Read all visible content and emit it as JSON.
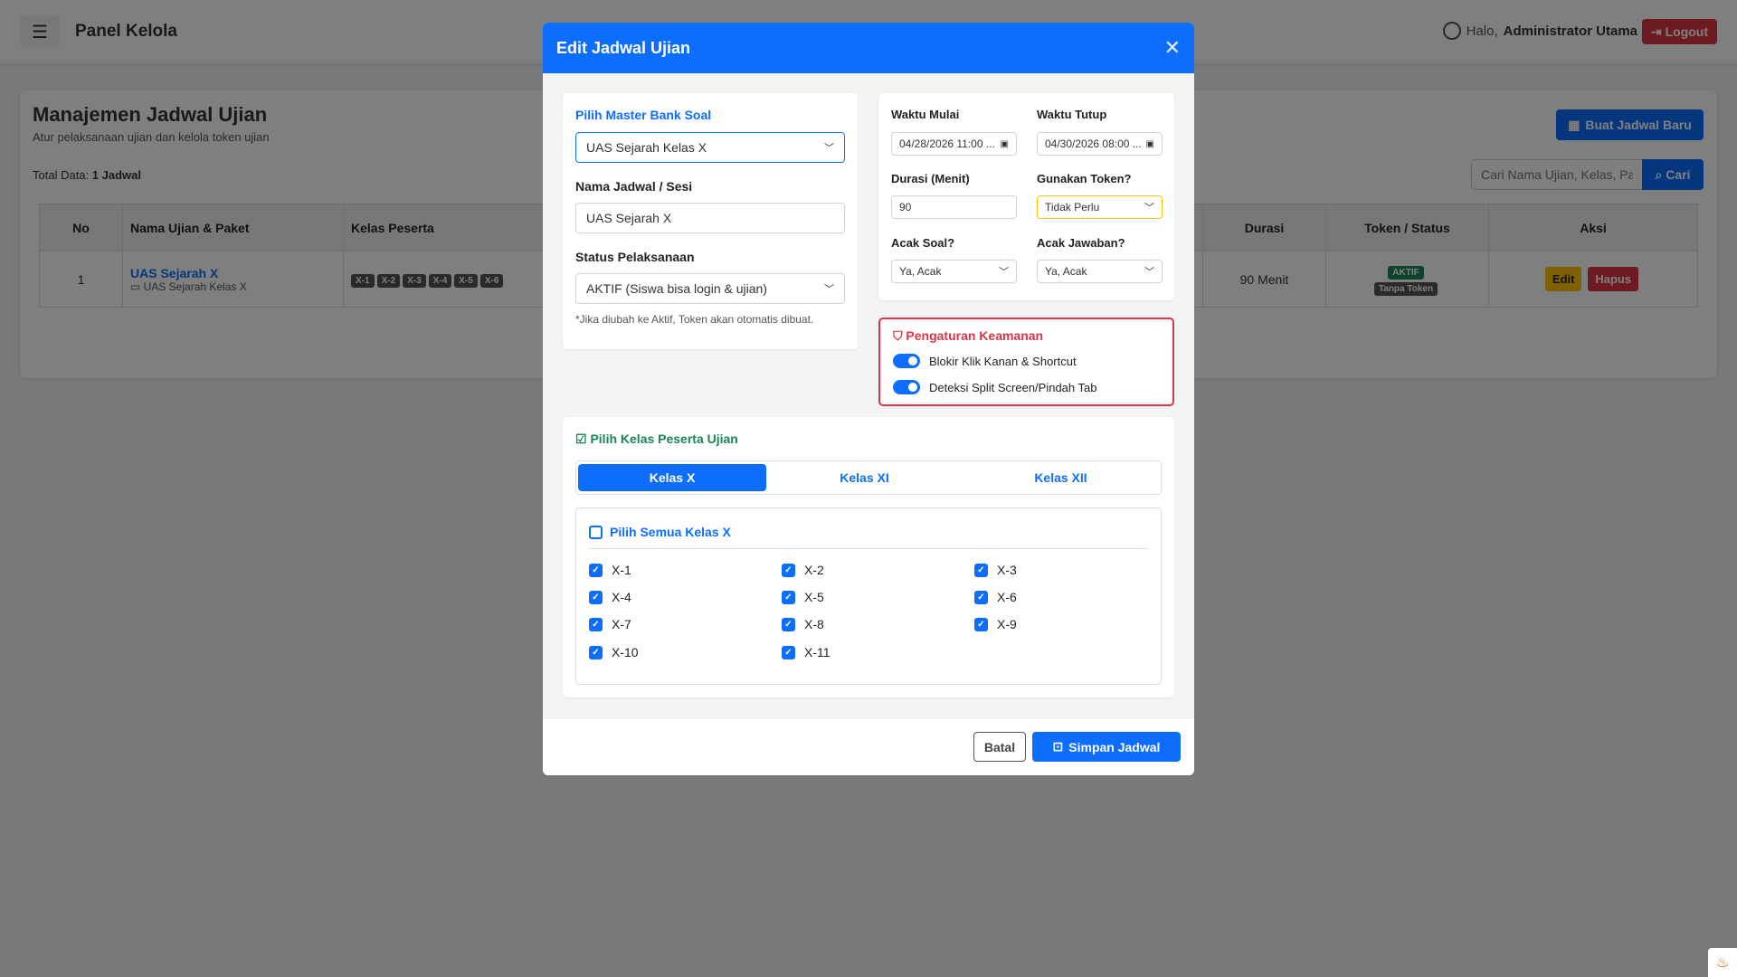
{
  "navbar": {
    "brand": "Panel Kelola",
    "greeting": "Halo,",
    "user": "Administrator Utama",
    "logout": "Logout"
  },
  "page": {
    "title": "Manajemen Jadwal Ujian",
    "subtitle": "Atur pelaksanaan ujian dan kelola token ujian",
    "total_label": "Total Data:",
    "total_value": "1 Jadwal",
    "new_button": "Buat Jadwal Baru",
    "search_placeholder": "Cari Nama Ujian, Kelas, Paket...",
    "search_button": "Cari"
  },
  "table": {
    "headers": [
      "No",
      "Nama Ujian & Paket",
      "Kelas Peserta",
      "Durasi",
      "Token / Status",
      "Aksi"
    ],
    "rows": [
      {
        "no": "1",
        "name": "UAS Sejarah X",
        "package": "UAS Sejarah Kelas X",
        "classes": [
          "X-1",
          "X-2",
          "X-3",
          "X-4",
          "X-5",
          "X-6"
        ],
        "duration": "90 Menit",
        "status": "AKTIF",
        "token": "Tanpa Token",
        "edit": "Edit",
        "delete": "Hapus"
      }
    ]
  },
  "modal": {
    "title": "Edit Jadwal Ujian",
    "bank_label": "Pilih Master Bank Soal",
    "bank_value": "UAS Sejarah Kelas X",
    "session_label": "Nama Jadwal / Sesi",
    "session_value": "UAS Sejarah X",
    "status_label": "Status Pelaksanaan",
    "status_value": "AKTIF (Siswa bisa login & ujian)",
    "status_note": "*Jika diubah ke Aktif, Token akan otomatis dibuat.",
    "start_label": "Waktu Mulai",
    "start_value": "04/28/2026 11:00 ...",
    "end_label": "Waktu Tutup",
    "end_value": "04/30/2026 08:00 ...",
    "duration_label": "Durasi (Menit)",
    "duration_value": "90",
    "token_label": "Gunakan Token?",
    "token_value": "Tidak Perlu",
    "shuffle_q_label": "Acak Soal?",
    "shuffle_q_value": "Ya, Acak",
    "shuffle_a_label": "Acak Jawaban?",
    "shuffle_a_value": "Ya, Acak",
    "security_title": "Pengaturan Keamanan",
    "security_opt1": "Blokir Klik Kanan & Shortcut",
    "security_opt2": "Deteksi Split Screen/Pindah Tab",
    "class_title": "Pilih Kelas Peserta Ujian",
    "tabs": [
      "Kelas X",
      "Kelas XI",
      "Kelas XII"
    ],
    "select_all": "Pilih Semua Kelas X",
    "classes": [
      "X-1",
      "X-2",
      "X-3",
      "X-4",
      "X-5",
      "X-6",
      "X-7",
      "X-8",
      "X-9",
      "X-10",
      "X-11"
    ],
    "cancel": "Batal",
    "save": "Simpan Jadwal"
  },
  "colors": {
    "primary": "#0d6efd",
    "danger": "#dc3545",
    "success": "#198754",
    "warning": "#ffc107"
  }
}
